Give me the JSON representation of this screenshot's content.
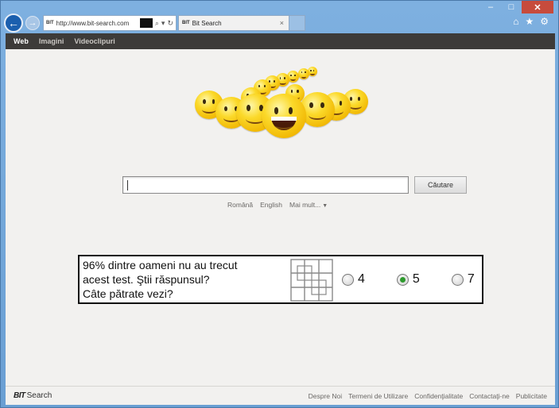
{
  "browser": {
    "address_url": "http://www.bit-search.com",
    "tab_title": "Bit Search",
    "tab_favicon": "BIT",
    "tab_close": "×",
    "back_glyph": "←",
    "fwd_glyph": "→",
    "search_glyph": "⌕",
    "dropdown_glyph": "▾",
    "refresh_glyph": "↻",
    "tools": {
      "home": "⌂",
      "favorites": "★",
      "settings": "⚙"
    },
    "window": {
      "minimize": "‒",
      "maximize": "□",
      "close": "✕"
    }
  },
  "topnav": {
    "items": [
      {
        "label": "Web",
        "active": true
      },
      {
        "label": "Imagini",
        "active": false
      },
      {
        "label": "Videoclipuri",
        "active": false
      }
    ]
  },
  "search": {
    "value": "",
    "button_label": "Căutare"
  },
  "languages": {
    "items": [
      "Română",
      "English"
    ],
    "more_label": "Mai mult...",
    "more_arrow": "▼"
  },
  "quiz": {
    "line1": "96% dintre oameni nu au trecut",
    "line2": "acest test. Ştii răspunsul?",
    "line3": "Câte pătrate vezi?",
    "options": [
      {
        "label": "4",
        "selected": false
      },
      {
        "label": "5",
        "selected": true
      },
      {
        "label": "7",
        "selected": false
      }
    ]
  },
  "footer": {
    "logo_bit": "BIT",
    "logo_text": "Search",
    "links": [
      "Despre Noi",
      "Termeni de Utilizare",
      "Confidenţialitate",
      "Contactaţi-ne",
      "Publicitate"
    ]
  },
  "colors": {
    "topnav_bg": "#3d3b39",
    "page_bg": "#f2f1ef",
    "radio_selected": "#2e9a2e",
    "smiley_yellow": "#fbd92a"
  }
}
